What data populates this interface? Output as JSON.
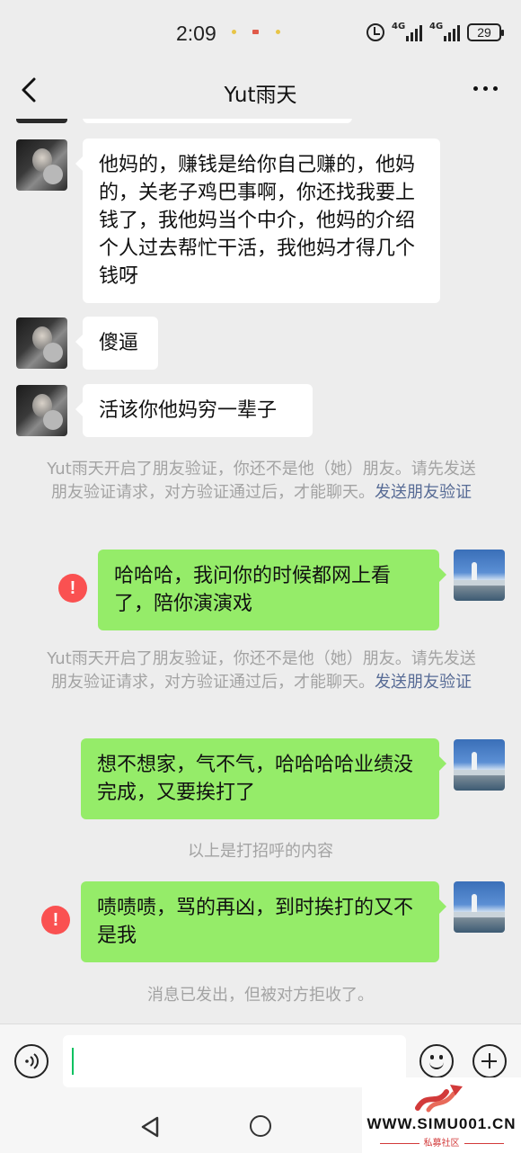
{
  "status_bar": {
    "time": "2:09",
    "network_1": "4G",
    "network_2": "4G",
    "battery": "29"
  },
  "header": {
    "title": "Yut雨天"
  },
  "messages": [
    {
      "dir": "in",
      "text": "他妈的，赚钱是给你自己赚的，他妈的，关老子鸡巴事啊，你还找我要上钱了，我他妈当个中介，他妈的介绍个人过去帮忙干活，我他妈才得几个钱呀"
    },
    {
      "dir": "in",
      "text": "傻逼"
    },
    {
      "dir": "in",
      "text": "活该你他妈穷一辈子"
    },
    {
      "dir": "out",
      "text": "哈哈哈，我问你的时候都网上看了，陪你演演戏",
      "failed": true
    },
    {
      "dir": "out",
      "text": "想不想家，气不气，哈哈哈哈业绩没完成，又要挨打了",
      "failed": false
    },
    {
      "dir": "out",
      "text": "啧啧啧，骂的再凶，到时挨打的又不是我",
      "failed": true
    }
  ],
  "system_notes": {
    "verify_text": "Yut雨天开启了朋友验证，你还不是他（她）朋友。请先发送朋友验证请求，对方验证通过后，才能聊天。",
    "verify_link": "发送朋友验证",
    "greeting_divider": "以上是打招呼的内容",
    "rejected": "消息已发出，但被对方拒收了。"
  },
  "error_mark": "!",
  "input": {
    "value": ""
  },
  "watermark": {
    "site": "WWW.SIMU001.CN",
    "label": "私募社区"
  },
  "colors": {
    "background": "#ededed",
    "outgoing_bubble": "#95ec69",
    "incoming_bubble": "#ffffff",
    "link": "#576b95",
    "error": "#fa5151",
    "system_text": "#a3a3a3"
  }
}
